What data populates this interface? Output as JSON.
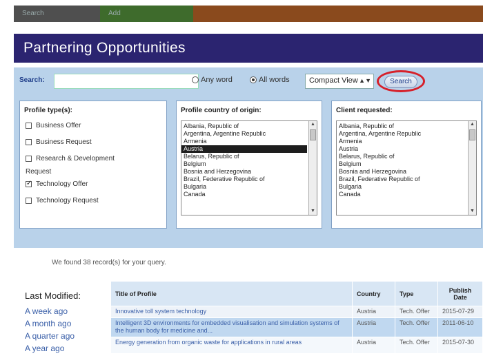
{
  "top_tabs": [
    "Search",
    "Add",
    ""
  ],
  "page_title": "Partnering Opportunities",
  "search": {
    "label": "Search:",
    "value": "",
    "radio_any": "Any word",
    "radio_all": "All words",
    "selected_radio": "all",
    "view_option": "Compact View",
    "button": "Search"
  },
  "profile_types": {
    "title": "Profile type(s):",
    "options": [
      {
        "label": "Business Offer",
        "checked": false
      },
      {
        "label": "Business Request",
        "checked": false
      },
      {
        "label": "Research & Development",
        "checked": false
      }
    ],
    "group_label": "Request",
    "group_options": [
      {
        "label": "Technology Offer",
        "checked": true
      },
      {
        "label": "Technology Request",
        "checked": false
      }
    ]
  },
  "origin": {
    "title": "Profile country of origin:",
    "items": [
      "Albania, Republic of",
      "Argentina, Argentine Republic",
      "Armenia",
      "Austria",
      "Belarus, Republic of",
      "Belgium",
      "Bosnia and Herzegovina",
      "Brazil, Federative Republic of",
      "Bulgaria",
      "Canada"
    ],
    "selected_index": 3
  },
  "client": {
    "title": "Client requested:",
    "items": [
      "Albania, Republic of",
      "Argentina, Argentine Republic",
      "Armenia",
      "Austria",
      "Belarus, Republic of",
      "Belgium",
      "Bosnia and Herzegovina",
      "Brazil, Federative Republic of",
      "Bulgaria",
      "Canada"
    ]
  },
  "results_count": "We found 38 record(s) for your query.",
  "last_modified": {
    "title": "Last Modified:",
    "links": [
      "A week ago",
      "A month ago",
      "A quarter ago",
      "A year ago"
    ]
  },
  "table": {
    "headers": [
      "Title of Profile",
      "Country",
      "Type",
      "Publish Date"
    ],
    "rows": [
      {
        "title": "Innovative toll system technology",
        "country": "Austria",
        "type": "Tech. Offer",
        "date": "2015-07-29"
      },
      {
        "title": "Intelligent 3D environments for embedded visualisation and simulation systems of the human body for medicine and...",
        "country": "Austria",
        "type": "Tech. Offer",
        "date": "2011-06-10"
      },
      {
        "title": "Energy generation from organic waste for applications in rural areas",
        "country": "Austria",
        "type": "Tech. Offer",
        "date": "2015-07-30"
      }
    ]
  }
}
